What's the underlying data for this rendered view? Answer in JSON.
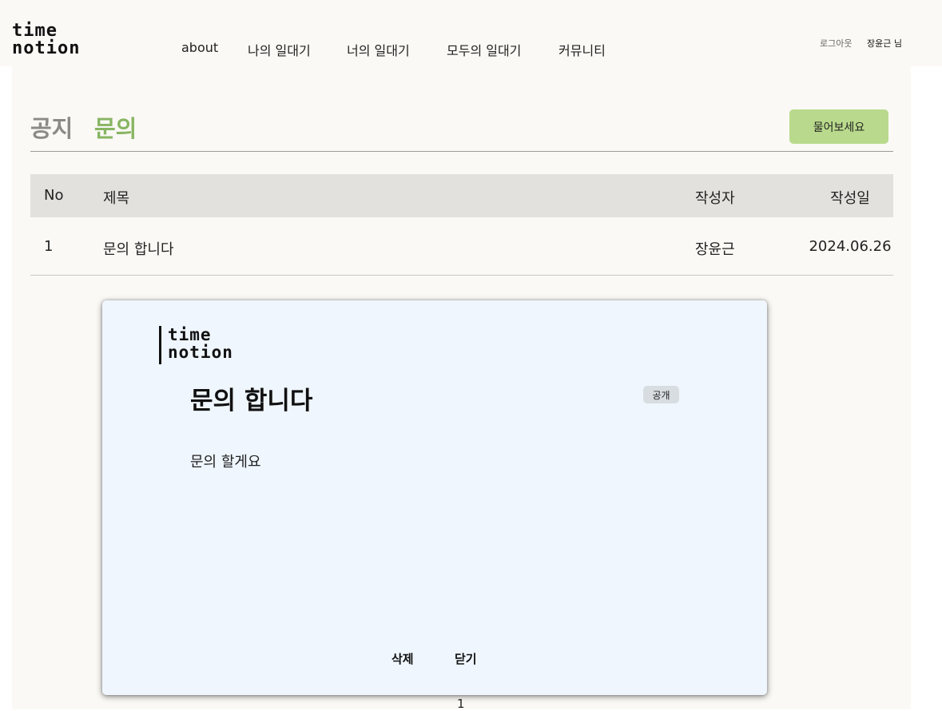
{
  "header": {
    "logo": {
      "line1": "time",
      "line2": "notion"
    },
    "nav": [
      "about",
      "나의 일대기",
      "너의 일대기",
      "모두의 일대기",
      "커뮤니티"
    ],
    "logout_label": "로그아웃",
    "user_label": "장윤근 님"
  },
  "board": {
    "tabs": {
      "notice": "공지",
      "inquiry": "문의"
    },
    "ask_button": "물어보세요",
    "columns": {
      "no": "No",
      "title": "제목",
      "author": "작성자",
      "date": "작성일"
    },
    "rows": [
      {
        "no": "1",
        "title": "문의 합니다",
        "author": "장윤근",
        "date": "2024.06.26"
      }
    ]
  },
  "modal": {
    "logo": {
      "line1": "time",
      "line2": "notion"
    },
    "title": "문의 합니다",
    "visibility_badge": "공개",
    "body": "문의 할게요",
    "delete_button": "삭제",
    "close_button": "닫기"
  },
  "pagination": {
    "current_page": "1"
  },
  "colors": {
    "background": "#faf9f5",
    "accent_green": "#88b563",
    "button_green": "#b9da8c",
    "table_header": "#e2e1dd",
    "modal_bg": "#eff6fd"
  }
}
